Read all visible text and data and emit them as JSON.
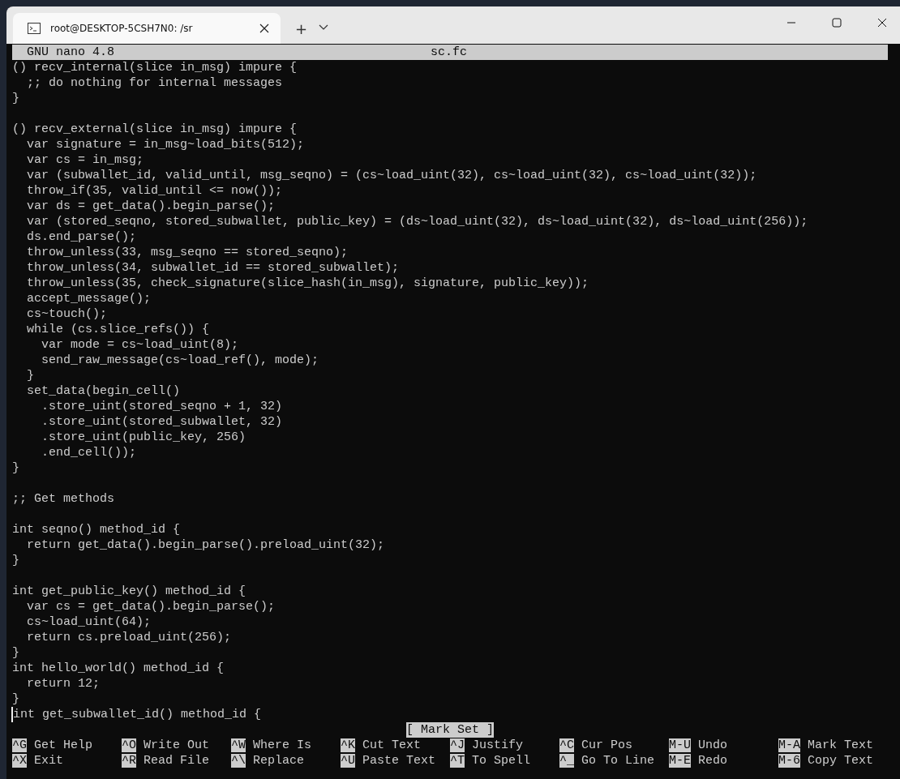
{
  "window": {
    "tab_title": "root@DESKTOP-5CSH7N0: /sr",
    "new_tab": "+"
  },
  "nano": {
    "version": "GNU nano 4.8",
    "filename": "sc.fc",
    "status": "[ Mark Set ]"
  },
  "lines": [
    {
      "kind": "code",
      "text": "() recv_internal(slice in_msg) impure {"
    },
    {
      "kind": "code",
      "text": "  ;; do nothing for internal messages"
    },
    {
      "kind": "code",
      "text": "}"
    },
    {
      "kind": "blank"
    },
    {
      "kind": "code",
      "text": "() recv_external(slice in_msg) impure {"
    },
    {
      "kind": "code",
      "text": "  var signature = in_msg~load_bits(512);"
    },
    {
      "kind": "code",
      "text": "  var cs = in_msg;"
    },
    {
      "kind": "code",
      "text": "  var (subwallet_id, valid_until, msg_seqno) = (cs~load_uint(32), cs~load_uint(32), cs~load_uint(32));"
    },
    {
      "kind": "code",
      "text": "  throw_if(35, valid_until <= now());"
    },
    {
      "kind": "code",
      "text": "  var ds = get_data().begin_parse();"
    },
    {
      "kind": "code",
      "text": "  var (stored_seqno, stored_subwallet, public_key) = (ds~load_uint(32), ds~load_uint(32), ds~load_uint(256));"
    },
    {
      "kind": "code",
      "text": "  ds.end_parse();"
    },
    {
      "kind": "code",
      "text": "  throw_unless(33, msg_seqno == stored_seqno);"
    },
    {
      "kind": "code",
      "text": "  throw_unless(34, subwallet_id == stored_subwallet);"
    },
    {
      "kind": "code",
      "text": "  throw_unless(35, check_signature(slice_hash(in_msg), signature, public_key));"
    },
    {
      "kind": "code",
      "text": "  accept_message();"
    },
    {
      "kind": "code",
      "text": "  cs~touch();"
    },
    {
      "kind": "code",
      "text": "  while (cs.slice_refs()) {"
    },
    {
      "kind": "code",
      "text": "    var mode = cs~load_uint(8);"
    },
    {
      "kind": "code",
      "text": "    send_raw_message(cs~load_ref(), mode);"
    },
    {
      "kind": "code",
      "text": "  }"
    },
    {
      "kind": "code",
      "text": "  set_data(begin_cell()"
    },
    {
      "kind": "code",
      "text": "    .store_uint(stored_seqno + 1, 32)"
    },
    {
      "kind": "code",
      "text": "    .store_uint(stored_subwallet, 32)"
    },
    {
      "kind": "code",
      "text": "    .store_uint(public_key, 256)"
    },
    {
      "kind": "code",
      "text": "    .end_cell());"
    },
    {
      "kind": "code",
      "text": "}"
    },
    {
      "kind": "blank"
    },
    {
      "kind": "code",
      "text": ";; Get methods"
    },
    {
      "kind": "blank"
    },
    {
      "kind": "code",
      "text": "int seqno() method_id {"
    },
    {
      "kind": "code",
      "text": "  return get_data().begin_parse().preload_uint(32);"
    },
    {
      "kind": "code",
      "text": "}"
    },
    {
      "kind": "blank"
    },
    {
      "kind": "code",
      "text": "int get_public_key() method_id {"
    },
    {
      "kind": "code",
      "text": "  var cs = get_data().begin_parse();"
    },
    {
      "kind": "code",
      "text": "  cs~load_uint(64);"
    },
    {
      "kind": "code",
      "text": "  return cs.preload_uint(256);"
    },
    {
      "kind": "code",
      "text": "}"
    },
    {
      "kind": "code",
      "text": "int hello_world() method_id {"
    },
    {
      "kind": "code",
      "text": "  return 12;"
    },
    {
      "kind": "code",
      "text": "}"
    },
    {
      "kind": "cursor",
      "text": "int get_subwallet_id() method_id {"
    }
  ],
  "shortcuts": [
    [
      {
        "key": "^G",
        "label": "Get Help"
      },
      {
        "key": "^X",
        "label": "Exit"
      }
    ],
    [
      {
        "key": "^O",
        "label": "Write Out"
      },
      {
        "key": "^R",
        "label": "Read File"
      }
    ],
    [
      {
        "key": "^W",
        "label": "Where Is"
      },
      {
        "key": "^\\",
        "label": "Replace"
      }
    ],
    [
      {
        "key": "^K",
        "label": "Cut Text"
      },
      {
        "key": "^U",
        "label": "Paste Text"
      }
    ],
    [
      {
        "key": "^J",
        "label": "Justify"
      },
      {
        "key": "^T",
        "label": "To Spell"
      }
    ],
    [
      {
        "key": "^C",
        "label": "Cur Pos"
      },
      {
        "key": "^_",
        "label": "Go To Line"
      }
    ],
    [
      {
        "key": "M-U",
        "label": "Undo"
      },
      {
        "key": "M-E",
        "label": "Redo"
      }
    ],
    [
      {
        "key": "M-A",
        "label": "Mark Text"
      },
      {
        "key": "M-6",
        "label": "Copy Text"
      }
    ]
  ]
}
